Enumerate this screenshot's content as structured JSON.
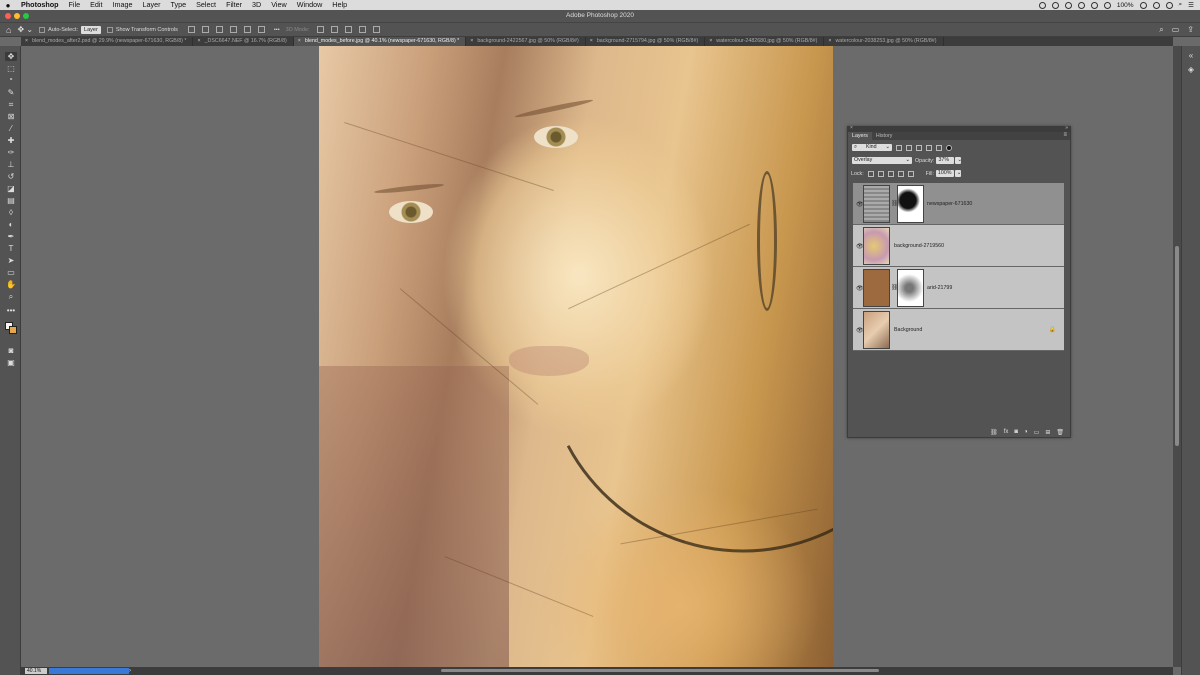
{
  "menubar": {
    "apple": "",
    "items": [
      "Photoshop",
      "File",
      "Edit",
      "Image",
      "Layer",
      "Type",
      "Select",
      "Filter",
      "3D",
      "View",
      "Window",
      "Help"
    ],
    "battery": "100%",
    "clock": ""
  },
  "titlebar": {
    "title": "Adobe Photoshop 2020"
  },
  "options": {
    "auto_select_label": "Auto-Select:",
    "auto_select_value": "Layer",
    "show_transform_label": "Show Transform Controls",
    "mode_3d_label": "3D Mode:"
  },
  "tabs": [
    {
      "label": "blend_modes_after2.psd @ 29.9% (newspaper-671630, RGB/8) *",
      "active": false
    },
    {
      "label": "_DSC6647.NEF @ 16.7% (RGB/8)",
      "active": false
    },
    {
      "label": "blend_modes_before.jpg @ 40.1% (newspaper-671630, RGB/8) *",
      "active": true
    },
    {
      "label": "background-2422567.jpg @ 50% (RGB/8#)",
      "active": false
    },
    {
      "label": "background-2715794.jpg @ 50% (RGB/8#)",
      "active": false
    },
    {
      "label": "watercolour-2482680.jpg @ 50% (RGB/8#)",
      "active": false
    },
    {
      "label": "watercolour-2038253.jpg @ 50% (RGB/8#)",
      "active": false
    }
  ],
  "status": {
    "zoom": "40.1%"
  },
  "layers_panel": {
    "tabs": [
      "Layers",
      "History"
    ],
    "filter_kind": "Kind",
    "blend_mode": "Overlay",
    "opacity_label": "Opacity:",
    "opacity_value": "37%",
    "lock_label": "Lock:",
    "fill_label": "Fill:",
    "fill_value": "100%",
    "layers": [
      {
        "name": "newspaper-671630",
        "active": true,
        "has_mask": true,
        "locked": false
      },
      {
        "name": "background-2719560",
        "active": false,
        "has_mask": false,
        "locked": false
      },
      {
        "name": "arid-21799",
        "active": false,
        "has_mask": true,
        "locked": false
      },
      {
        "name": "Background",
        "active": false,
        "has_mask": false,
        "locked": true
      }
    ]
  },
  "colors": {
    "accent": "#3b79d6",
    "panel": "#535353",
    "canvas": "#6b6b6b"
  }
}
